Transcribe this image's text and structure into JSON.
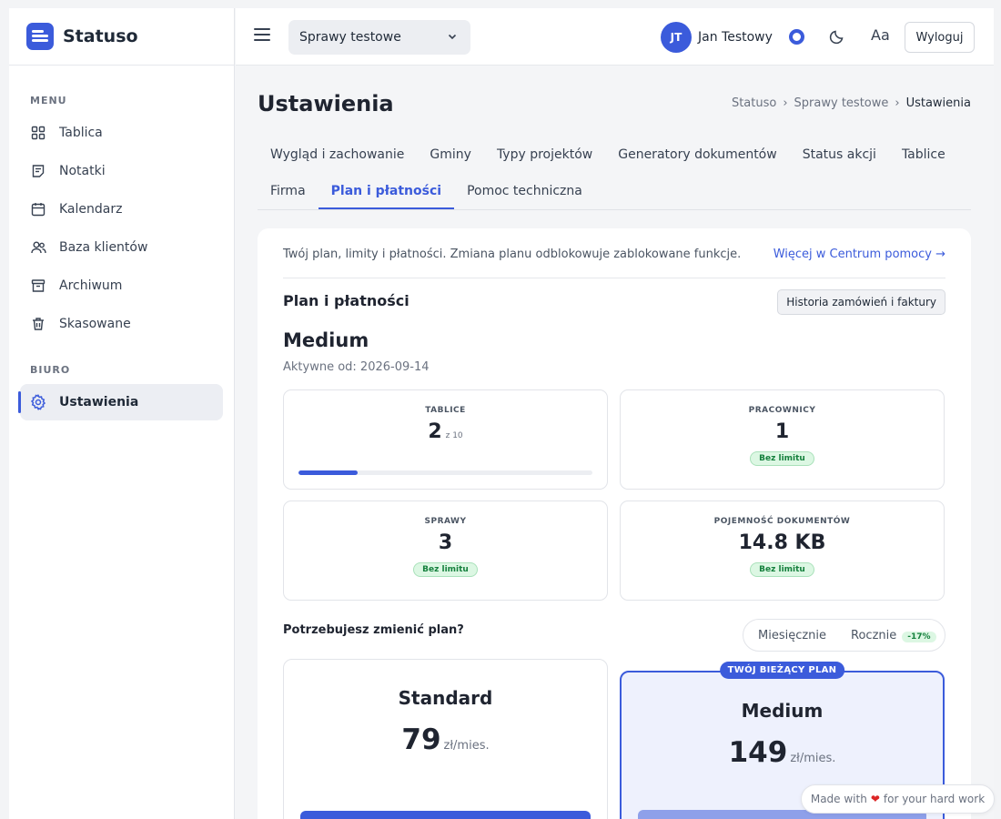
{
  "app": {
    "name": "Statuso",
    "accent": "#3b5bdb"
  },
  "sidebar": {
    "sections": [
      {
        "label": "MENU",
        "items": [
          {
            "label": "Tablica",
            "icon": "grid-icon"
          },
          {
            "label": "Notatki",
            "icon": "note-icon"
          },
          {
            "label": "Kalendarz",
            "icon": "calendar-icon"
          },
          {
            "label": "Baza klientów",
            "icon": "users-icon"
          },
          {
            "label": "Archiwum",
            "icon": "archive-icon"
          },
          {
            "label": "Skasowane",
            "icon": "trash-icon"
          }
        ]
      },
      {
        "label": "BIURO",
        "items": [
          {
            "label": "Ustawienia",
            "icon": "gear-icon",
            "active": true
          }
        ]
      }
    ]
  },
  "topbar": {
    "case_select": "Sprawy testowe",
    "user_initials": "JT",
    "user_name": "Jan Testowy",
    "font_label": "Aa",
    "logout_label": "Wyloguj"
  },
  "page": {
    "title": "Ustawienia",
    "breadcrumb": [
      "Statuso",
      "Sprawy testowe",
      "Ustawienia"
    ],
    "tabs_row1": [
      "Wygląd i zachowanie",
      "Gminy",
      "Typy projektów",
      "Generatory dokumentów",
      "Status akcji",
      "Tablice"
    ],
    "tabs_row2": [
      "Firma",
      "Plan i płatności",
      "Pomoc techniczna"
    ],
    "active_tab": "Plan i płatności"
  },
  "billing": {
    "intro": "Twój plan, limity i płatności. Zmiana planu odblokowuje zablokowane funkcje.",
    "help_link": "Więcej w Centrum pomocy →",
    "section_title": "Plan i płatności",
    "history_button": "Historia zamówień i faktury",
    "current_plan": "Medium",
    "active_since": "Aktywne od: 2026-09-14",
    "stats": [
      {
        "label": "TABLICE",
        "value": "2",
        "limit": "z 10",
        "progress": 0.2
      },
      {
        "label": "PRACOWNICY",
        "value": "1",
        "badge": "Bez limitu"
      },
      {
        "label": "SPRAWY",
        "value": "3",
        "badge": "Bez limitu"
      },
      {
        "label": "POJEMNOŚĆ DOKUMENTÓW",
        "value": "14.8 KB",
        "badge": "Bez limitu"
      }
    ],
    "change_title": "Potrzebujesz zmienić plan?",
    "toggle": {
      "monthly": "Miesięcznie",
      "yearly": "Rocznie",
      "discount": "-17%"
    },
    "plans": [
      {
        "name": "Standard",
        "price": "79",
        "unit": "zł/mies."
      },
      {
        "name": "Medium",
        "price": "149",
        "unit": "zł/mies.",
        "badge": "TWÓJ BIEŻĄCY PLAN"
      }
    ]
  },
  "footer": {
    "made_with_pre": "Made with",
    "made_with_post": "for your hard work"
  }
}
